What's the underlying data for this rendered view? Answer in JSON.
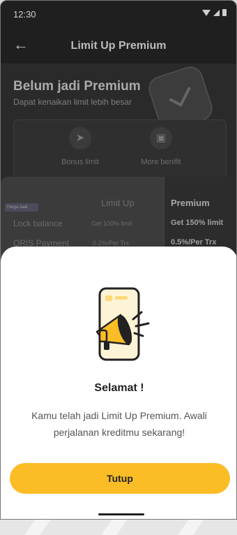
{
  "status_bar": {
    "time": "12:30"
  },
  "app_bar": {
    "title": "Limit Up Premium"
  },
  "hero": {
    "title": "Belum jadi Premium",
    "subtitle": "Dapat kenaikan limit lebih besar",
    "benefits": [
      {
        "label": "Bonus limit",
        "icon": "rocket-icon"
      },
      {
        "label": "More benifit",
        "icon": "gift-icon"
      }
    ]
  },
  "comparison": {
    "tag": "Harga saat",
    "col_limit_up": "Limit Up",
    "col_premium": "Premium",
    "rows": [
      {
        "label": "Lock balance",
        "limit_up": "Get 100% limit",
        "premium": "Get 150% limit"
      },
      {
        "label": "QRIS Payment",
        "limit_up": "0.2%/Per Trx",
        "premium": "0.5%/Per Trx"
      }
    ]
  },
  "dialog": {
    "title": "Selamat !",
    "message": "Kamu telah jadi Limit Up Premium. Awali perjalanan kreditmu sekarang!",
    "button_label": "Tutup",
    "illustration": "megaphone-phone-icon"
  },
  "colors": {
    "accent": "#fbbd26",
    "overlay": "#1f1f1f",
    "sheet": "#ffffff"
  }
}
